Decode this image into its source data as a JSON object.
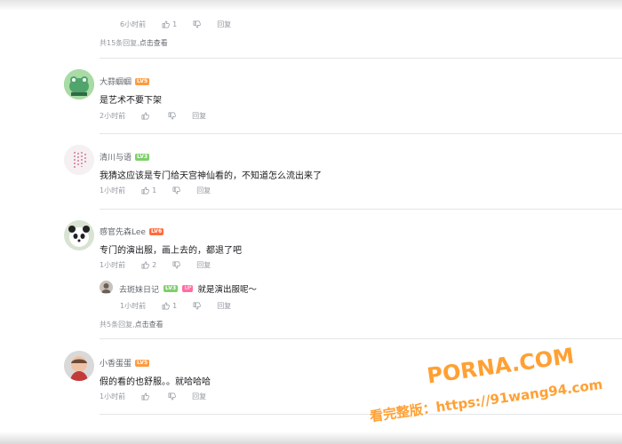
{
  "top_comment": {
    "partial_reply_time": "6小时前",
    "partial_reply_likes": "1",
    "reply_label": "回复",
    "more_prefix": "共15条回复,",
    "more_link": "点击查看"
  },
  "comments": [
    {
      "user": "大蒜蝈蝈",
      "level": "LV5",
      "text": "是艺术不要下架",
      "time": "2小时前",
      "likes": "",
      "reply_label": "回复"
    },
    {
      "user": "清川与语",
      "level": "LV3",
      "text": "我猜这应该是专门给天宫神仙看的，不知道怎么流出来了",
      "time": "1小时前",
      "likes": "1",
      "reply_label": "回复"
    },
    {
      "user": "感官先森Lee",
      "level": "LV6",
      "text": "专门的演出服，画上去的，都退了吧",
      "time": "1小时前",
      "likes": "2",
      "reply_label": "回复",
      "sub_reply": {
        "user": "去斑妹日记",
        "level": "LV3",
        "badge": "UP",
        "text": "就是演出服呢～",
        "time": "1小时前",
        "likes": "1",
        "reply_label": "回复"
      },
      "more_prefix": "共5条回复,",
      "more_link": "点击查看"
    },
    {
      "user": "小香蛋蛋",
      "level": "LV5",
      "text": "假的看的也舒服。。就哈哈哈",
      "time": "1小时前",
      "likes": "",
      "reply_label": "回复"
    }
  ],
  "watermark": {
    "site": "PORNA.COM",
    "line2": "看完整版：https://91wang94.com"
  },
  "colors": {
    "accent_link": "#61666d",
    "level_orange": "#ff9a3d",
    "level_green": "#7fcf6b",
    "up_pink": "#ff6ea0",
    "watermark": "#ffa033"
  }
}
